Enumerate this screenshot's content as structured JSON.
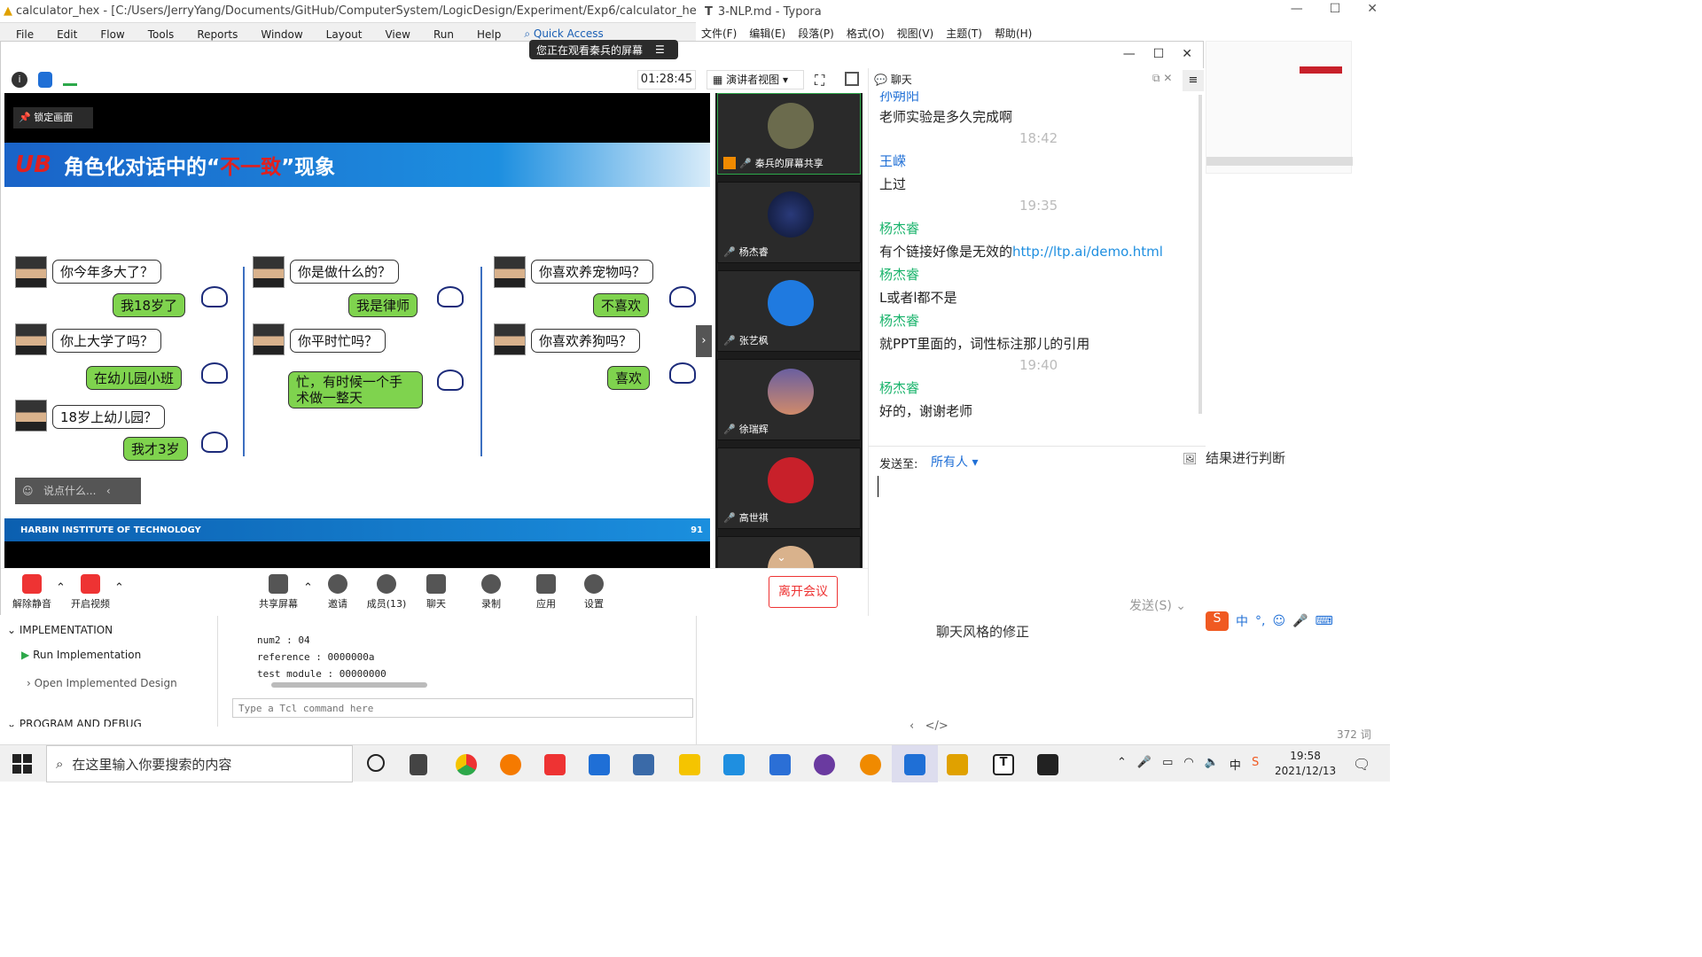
{
  "vivado": {
    "title": "calculator_hex - [C:/Users/JerryYang/Documents/GitHub/ComputerSystem/LogicDesign/Experiment/Exp6/calculator_hex/calcula",
    "menu": [
      "File",
      "Edit",
      "Flow",
      "Tools",
      "Reports",
      "Window",
      "Layout",
      "View",
      "Run",
      "Help"
    ],
    "quick_access": "Quick Access",
    "tree": {
      "section": "IMPLEMENTATION",
      "run": "Run Implementation",
      "open": "Open Implemented Design",
      "next_section": "PROGRAM AND DEBUG"
    },
    "console_lines": [
      "num2        : 04",
      "reference   : 0000000a",
      "test module : 00000000"
    ],
    "tcl_placeholder": "Type a Tcl command here"
  },
  "typora": {
    "title": "3-NLP.md - Typora",
    "menu": [
      "文件(F)",
      "编辑(E)",
      "段落(P)",
      "格式(O)",
      "视图(V)",
      "主题(T)",
      "帮助(H)"
    ],
    "text_judge": "结果进行判断",
    "text_fix": "聊天风格的修正",
    "word_count": "372 词"
  },
  "meeting": {
    "viewing_banner": "您正在观看秦兵的屏幕",
    "timer": "01:28:45",
    "view_mode": "演讲者视图",
    "chat_title": "聊天",
    "lock_label": "锁定画面",
    "comment_placeholder": "说点什么...",
    "slide": {
      "title_prefix": "角色化对话中的“",
      "title_highlight": "不一致",
      "title_suffix": "”现象",
      "footer": "HARBIN INSTITUTE OF TECHNOLOGY",
      "page": "91",
      "col1": [
        "你今年多大了？",
        "我18岁了",
        "你上大学了吗？",
        "在幼儿园小班",
        "18岁上幼儿园？",
        "我才3岁"
      ],
      "col2": [
        "你是做什么的？",
        "我是律师",
        "你平时忙吗？",
        "忙，有时候一个手术做一整天"
      ],
      "col3": [
        "你喜欢养宠物吗？",
        "不喜欢",
        "你喜欢养狗吗？",
        "喜欢"
      ]
    },
    "participants": [
      "秦兵的屏幕共享",
      "杨杰睿",
      "张艺枫",
      "徐瑞辉",
      "高世祺"
    ],
    "toolbar": [
      "解除静音",
      "开启视频",
      "共享屏幕",
      "邀请",
      "成员(13)",
      "聊天",
      "录制",
      "应用",
      "设置"
    ],
    "leave": "离开会议",
    "chat": {
      "messages": [
        {
          "kind": "name",
          "text": "孙朔阳",
          "color": "#1f6fd6"
        },
        {
          "kind": "msg",
          "text": "老师实验是多久完成啊"
        },
        {
          "kind": "time",
          "text": "18:42"
        },
        {
          "kind": "name",
          "text": "王嵘",
          "color": "#1f6fd6"
        },
        {
          "kind": "msg",
          "text": "上过"
        },
        {
          "kind": "time",
          "text": "19:35"
        },
        {
          "kind": "name",
          "text": "杨杰睿",
          "color": "#19b36b"
        },
        {
          "kind": "msg",
          "text": "有个链接好像是无效的",
          "link": "http://ltp.ai/demo.html"
        },
        {
          "kind": "name",
          "text": "杨杰睿",
          "color": "#19b36b"
        },
        {
          "kind": "msg",
          "text": "L或者l都不是"
        },
        {
          "kind": "name",
          "text": "杨杰睿",
          "color": "#19b36b"
        },
        {
          "kind": "msg",
          "text": "就PPT里面的，词性标注那儿的引用"
        },
        {
          "kind": "time",
          "text": "19:40"
        },
        {
          "kind": "name",
          "text": "杨杰睿",
          "color": "#19b36b"
        },
        {
          "kind": "msg",
          "text": "好的，谢谢老师"
        }
      ],
      "send_to_label": "发送至:",
      "send_to_value": "所有人",
      "send_button": "发送(S)"
    }
  },
  "taskbar": {
    "search": "在这里输入你要搜索的内容",
    "time": "19:58",
    "date": "2021/12/13",
    "ime": "中"
  }
}
